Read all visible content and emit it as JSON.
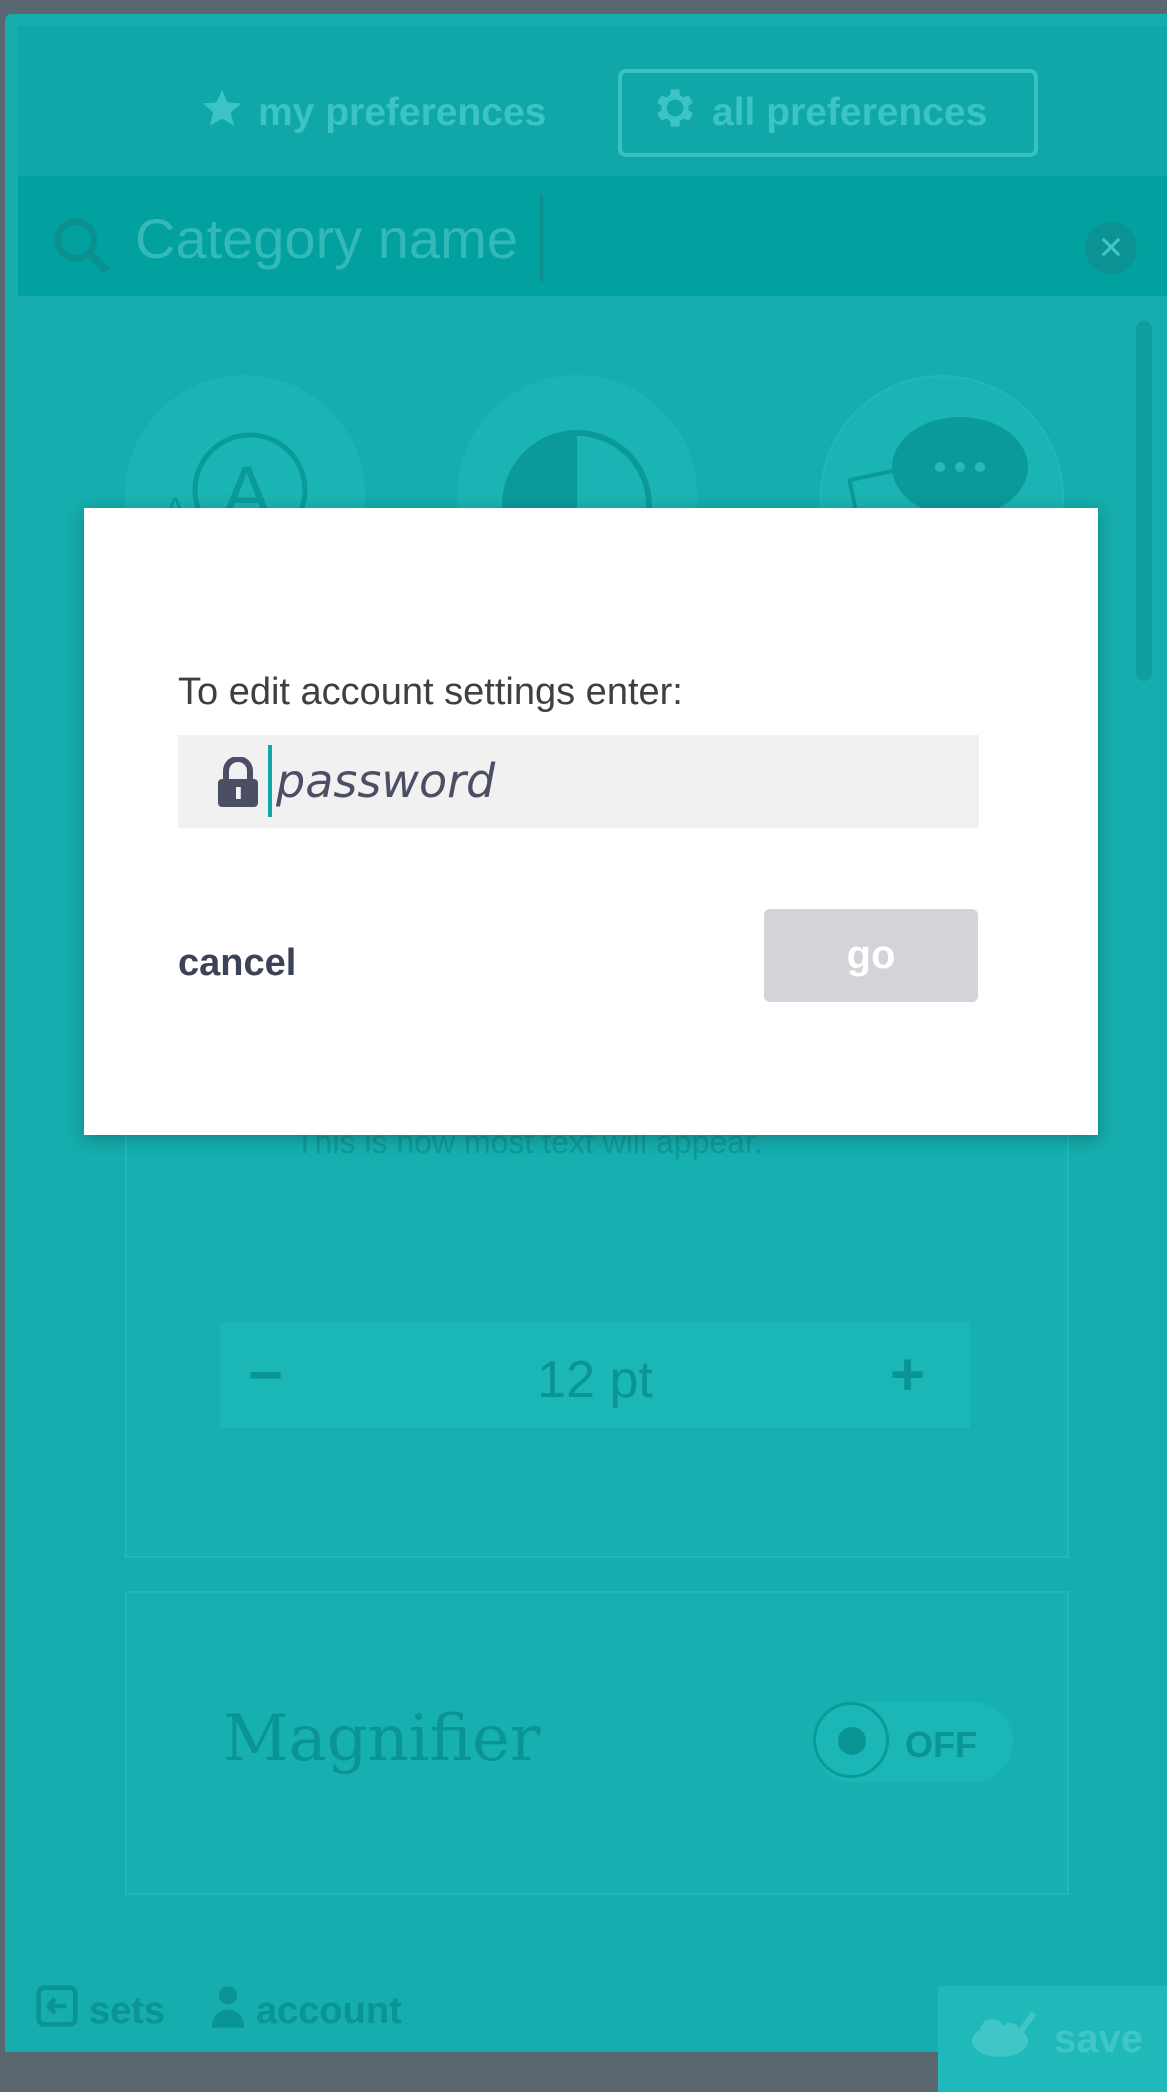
{
  "header": {
    "tab_my_preferences": "my preferences",
    "tab_all_preferences": "all preferences"
  },
  "search": {
    "placeholder": "Category name",
    "clear_label": "×"
  },
  "categories": [
    "A",
    "contrast",
    "text-to-speech"
  ],
  "text_size_panel": {
    "preview_text": "This is how most text will appear.",
    "value": "12 pt",
    "decrease": "−",
    "increase": "+"
  },
  "magnifier_panel": {
    "title": "Magnifier",
    "toggle_label": "OFF"
  },
  "footer": {
    "sets": "sets",
    "account": "account",
    "save": "save"
  },
  "dialog": {
    "prompt": "To edit account settings enter:",
    "password_placeholder": "password",
    "cancel": "cancel",
    "go": "go"
  },
  "colors": {
    "accent": "#15adad",
    "dialog_bg": "#ffffff",
    "field_bg": "#f1f1f1",
    "go_disabled": "#d3d4d8",
    "dark_text": "#3d4257"
  }
}
